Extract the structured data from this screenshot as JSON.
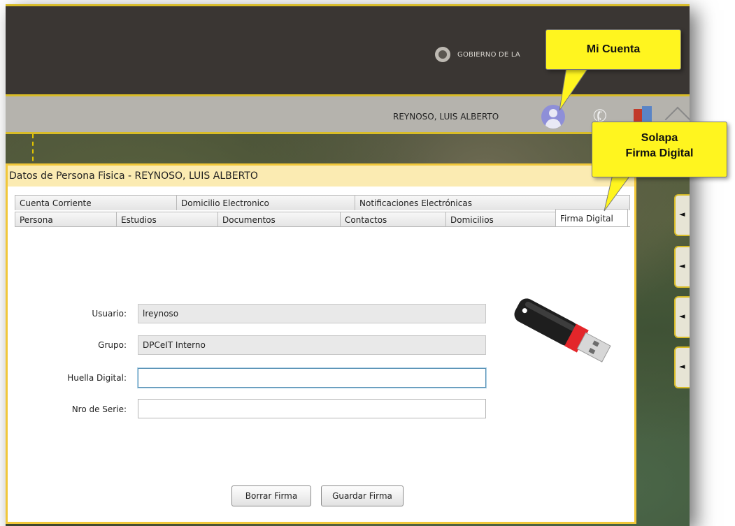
{
  "header": {
    "government_text": "GOBIERNO DE LA",
    "user_name": "REYNOSO, LUIS ALBERTO"
  },
  "icons": [
    "government-seal-icon",
    "user-avatar-icon",
    "telephone-icon",
    "exit-door-icon",
    "home-icon",
    "arrow-left-icon",
    "usb-drive-icon"
  ],
  "panel": {
    "title": "Datos de Persona Fisica - REYNOSO, LUIS ALBERTO",
    "tabs_row1": [
      "Cuenta Corriente",
      "Domicilio Electronico",
      "Notificaciones Electrónicas"
    ],
    "tabs_row2": [
      "Persona",
      "Estudios",
      "Documentos",
      "Contactos",
      "Domicilios",
      "Firma Digital"
    ],
    "active_tab": "Firma Digital"
  },
  "form": {
    "usuario_label": "Usuario:",
    "usuario_value": "lreynoso",
    "grupo_label": "Grupo:",
    "grupo_value": "DPCeIT Interno",
    "huella_label": "Huella Digital:",
    "huella_value": "",
    "serie_label": "Nro de Serie:",
    "serie_value": ""
  },
  "buttons": {
    "borrar": "Borrar Firma",
    "guardar": "Guardar Firma"
  },
  "side_tabs": [
    "◄",
    "◄",
    "◄",
    "◄"
  ],
  "callouts": {
    "mi_cuenta": "Mi Cuenta",
    "solapa_line1": "Solapa",
    "solapa_line2": "Firma Digital"
  },
  "colors": {
    "header_bg": "#3a3633",
    "accent_yellow": "#d8bc28",
    "panel_title_bg": "#fbebb2",
    "callout_bg": "#fff51f"
  }
}
